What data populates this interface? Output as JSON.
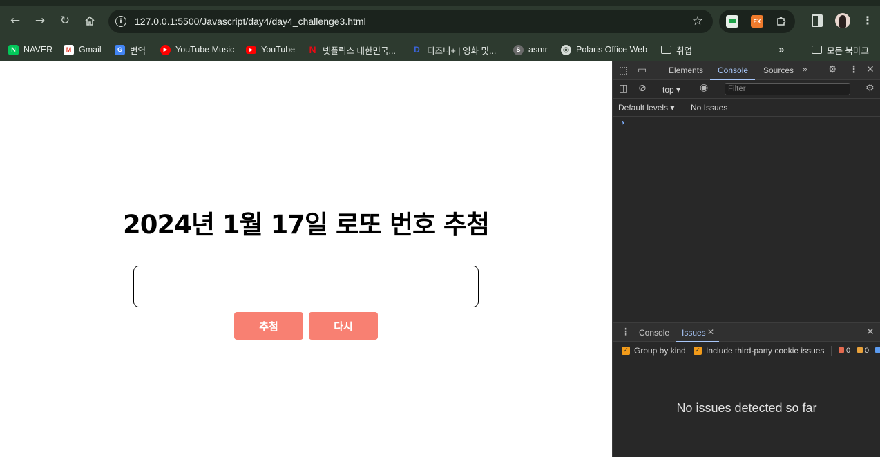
{
  "browser": {
    "url": "127.0.0.1:5500/Javascript/day4/day4_challenge3.html",
    "ext_label": "EX",
    "bookmarks": [
      {
        "label": "NAVER",
        "icon": "naver-icon",
        "color": "#03c75a",
        "glyph": "N"
      },
      {
        "label": "Gmail",
        "icon": "gmail-icon",
        "color": "#ea4335",
        "glyph": "M"
      },
      {
        "label": "번역",
        "icon": "translate-icon",
        "color": "#4285f4",
        "glyph": "G"
      },
      {
        "label": "YouTube Music",
        "icon": "youtube-music-icon",
        "color": "#ff0000",
        "glyph": "▶"
      },
      {
        "label": "YouTube",
        "icon": "youtube-icon",
        "color": "#ff0000",
        "glyph": "▶"
      },
      {
        "label": "넷플릭스 대한민국...",
        "icon": "netflix-icon",
        "color": "#e50914",
        "glyph": "N"
      },
      {
        "label": "디즈니+ | 영화 및...",
        "icon": "disney-plus-icon",
        "color": "#1a3fa8",
        "glyph": "D"
      },
      {
        "label": "asmr",
        "icon": "asmr-icon",
        "color": "#6b6b6b",
        "glyph": "S"
      },
      {
        "label": "Polaris Office Web",
        "icon": "globe-icon",
        "color": "#8a8a8a",
        "glyph": "◎"
      },
      {
        "label": "취업",
        "icon": "folder-icon",
        "color": "",
        "glyph": ""
      }
    ],
    "more_bookmarks_glyph": "»",
    "all_bookmarks": "모든 북마크"
  },
  "page": {
    "title": "2024년 1월 17일 로또 번호 추첨",
    "input_value": "",
    "draw_button": "추첨",
    "reset_button": "다시"
  },
  "devtools": {
    "tabs": [
      "Elements",
      "Console",
      "Sources"
    ],
    "active_tab": "Console",
    "context": "top",
    "filter_placeholder": "Filter",
    "levels": "Default levels",
    "issues_status": "No Issues",
    "drawer_tabs": [
      "Console",
      "Issues"
    ],
    "drawer_active": "Issues",
    "group_by_kind": "Group by kind",
    "third_party": "Include third-party cookie issues",
    "count_errors": "0",
    "count_warnings": "0",
    "empty_message": "No issues detected so far"
  }
}
